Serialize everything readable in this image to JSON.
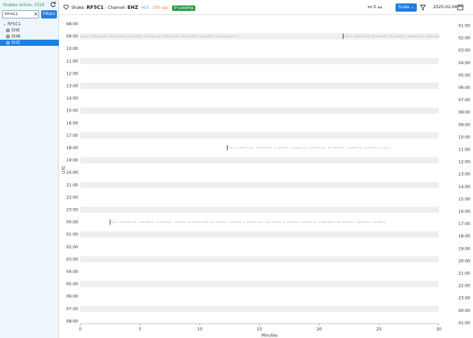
{
  "sidebar": {
    "shakes_online": "Shakes online: 2559",
    "search_value": "RF5C1",
    "filters_label": "Filters",
    "tree_root": "RF5C1",
    "channels": [
      "EHE",
      "EHN",
      "EHZ"
    ],
    "selected_channel": "EHZ"
  },
  "header": {
    "shake_prefix": "Shake:",
    "shake_name": "RF5C1",
    "channel_prefix": "- Channel:",
    "channel_name": "EHZ",
    "units": "M/S",
    "sps": "100 sps",
    "loading": "Loading",
    "counter": "0",
    "scale_label": "Scale",
    "date": "2025-02-04"
  },
  "colors": {
    "accent": "#1e7fe0",
    "loading": "#2e9b45",
    "trace": "#3a3aaa",
    "band": "#eeeeee"
  },
  "chart_data": {
    "type": "helicorder",
    "xlabel": "Minutes",
    "ylabel": "UTC",
    "x_ticks": [
      0,
      5,
      10,
      15,
      20,
      25,
      30
    ],
    "xlim": [
      0,
      30
    ],
    "left_labels": [
      "08:00",
      "09:00",
      "10:00",
      "11:00",
      "12:00",
      "13:00",
      "14:00",
      "15:00",
      "16:00",
      "17:00",
      "18:00",
      "19:00",
      "20:00",
      "21:00",
      "22:00",
      "23:00",
      "00:00",
      "01:00",
      "02:00",
      "03:00",
      "04:00",
      "05:00",
      "06:00",
      "07:00",
      "08:00"
    ],
    "right_labels": [
      "01:00",
      "02:00",
      "03:00",
      "04:00",
      "05:00",
      "06:00",
      "07:00",
      "08:00",
      "09:00",
      "10:00",
      "11:00",
      "12:00",
      "13:00",
      "14:00",
      "15:00",
      "16:00",
      "17:00",
      "18:00",
      "19:00",
      "20:00",
      "21:00",
      "22:00",
      "23:00",
      "00:00",
      "01:00"
    ],
    "traces": [
      {
        "row": 1,
        "x_start": 0,
        "x_end": 13,
        "spike_x": null
      },
      {
        "row": 1,
        "x_start": 22,
        "x_end": 30,
        "spike_x": 22
      },
      {
        "row": 10,
        "x_start": 12.3,
        "x_end": 26,
        "spike_x": 12.3
      },
      {
        "row": 16,
        "x_start": 2.5,
        "x_end": 25.5,
        "spike_x": 2.5
      }
    ]
  }
}
